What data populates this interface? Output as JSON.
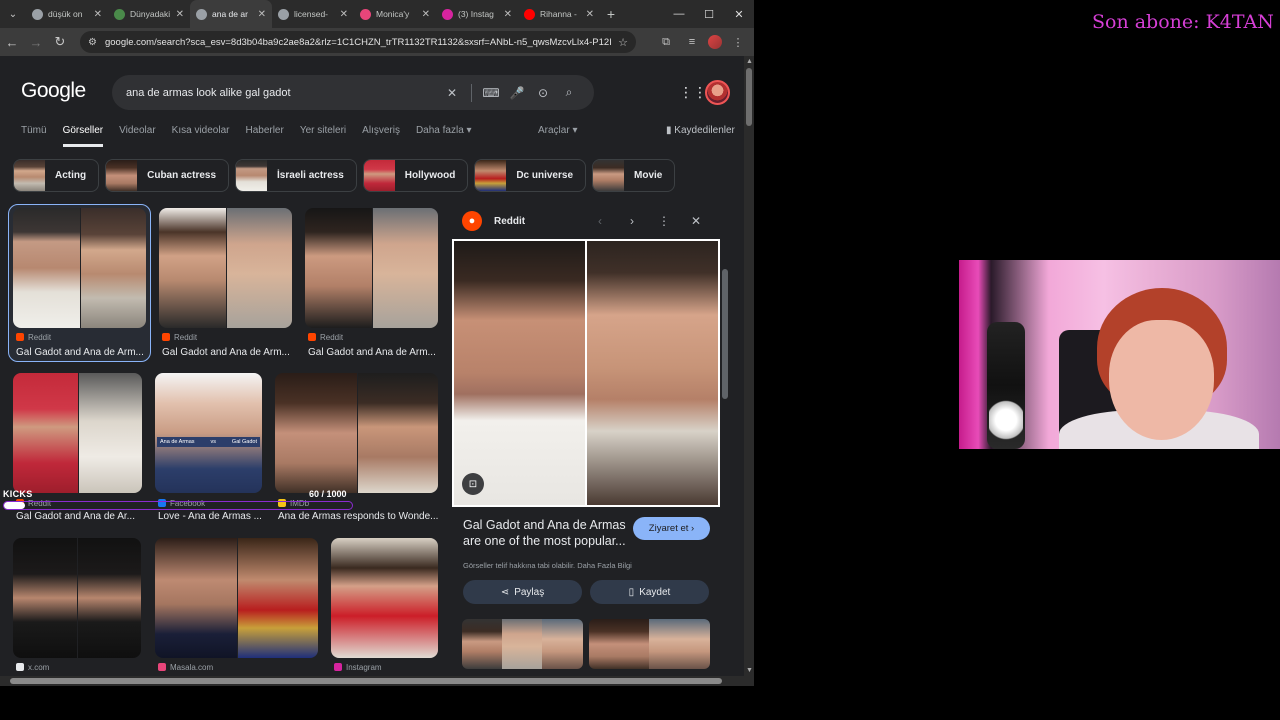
{
  "browser": {
    "tabs": [
      {
        "title": "düşük on",
        "fav_color": "#9aa0a6",
        "fav_icon": "google-icon",
        "active": false
      },
      {
        "title": "Dünyadaki",
        "fav_color": "#4a8a4a",
        "fav_icon": "site-icon",
        "active": false
      },
      {
        "title": "ana de ar",
        "fav_color": "#9aa0a6",
        "fav_icon": "google-icon",
        "active": true
      },
      {
        "title": "licensed-",
        "fav_color": "#9aa0a6",
        "fav_icon": "globe-icon",
        "active": false
      },
      {
        "title": "Monica'y",
        "fav_color": "#e8457a",
        "fav_icon": "monica-icon",
        "active": false
      },
      {
        "title": "(3) Instag",
        "fav_color": "#d6249f",
        "fav_icon": "instagram-icon",
        "active": false
      },
      {
        "title": "Rihanna -",
        "fav_color": "#ff0000",
        "fav_icon": "youtube-icon",
        "active": false
      }
    ],
    "url": "google.com/search?sca_esv=8d3b04ba9c2ae8a2&rlz=1C1CHZN_trTR1132TR1132&sxsrf=ANbL-n5_qwsMzcvLlx4-P12IGB..."
  },
  "google": {
    "logo": "Google",
    "query": "ana de armas look alike gal gadot",
    "nav_tabs": [
      {
        "label": "Tümü",
        "active": false
      },
      {
        "label": "Görseller",
        "active": true
      },
      {
        "label": "Videolar",
        "active": false
      },
      {
        "label": "Kısa videolar",
        "active": false
      },
      {
        "label": "Haberler",
        "active": false
      },
      {
        "label": "Yer siteleri",
        "active": false
      },
      {
        "label": "Alışveriş",
        "active": false
      },
      {
        "label": "Daha fazla ▾",
        "active": false
      }
    ],
    "tools_label": "Araçlar ▾",
    "saved_label": "Kaydedilenler",
    "chips": [
      "Acting",
      "Cuban actress",
      "İsraeli actress",
      "Hollywood",
      "Dc universe",
      "Movie"
    ]
  },
  "results": [
    {
      "source": "Reddit",
      "caption": "Gal Gadot and Ana de Arm...",
      "source_color": "#ff4500"
    },
    {
      "source": "Reddit",
      "caption": "Gal Gadot and Ana de Arm...",
      "source_color": "#ff4500"
    },
    {
      "source": "Reddit",
      "caption": "Gal Gadot and Ana de Arm...",
      "source_color": "#ff4500"
    },
    {
      "source": "Reddit",
      "caption": "Gal Gadot and Ana de Ar...",
      "source_color": "#ff4500"
    },
    {
      "source": "Facebook",
      "caption": "Love - Ana de Armas ...",
      "source_color": "#1877f2"
    },
    {
      "source": "IMDb",
      "caption": "Ana de Armas responds to Wonde...",
      "source_color": "#f5c518"
    },
    {
      "source": "x.com",
      "caption": "",
      "source_color": "#e8eaed"
    },
    {
      "source": "Masala.com",
      "caption": "",
      "source_color": "#e8457a"
    },
    {
      "source": "Instagram",
      "caption": "",
      "source_color": "#d6249f"
    }
  ],
  "comparison_table": {
    "headers": [
      "Ana de Armas",
      "vs",
      "Gal Gadot"
    ]
  },
  "panel": {
    "source": "Reddit",
    "title": "Gal Gadot and Ana de Armas are one of the most popular...",
    "visit_label": "Ziyaret et ›",
    "copyright": "Görseller telif hakkına tabi olabilir. Daha Fazla Bilgi",
    "share_label": "Paylaş",
    "save_label": "Kaydet"
  },
  "overlay": {
    "kicks_label": "KICKS",
    "kicks_count": "60 / 1000",
    "kicks_progress": 0.06,
    "subscriber_text": "Son abone: K4TAN",
    "subscriber_color": "#d63fd6"
  }
}
